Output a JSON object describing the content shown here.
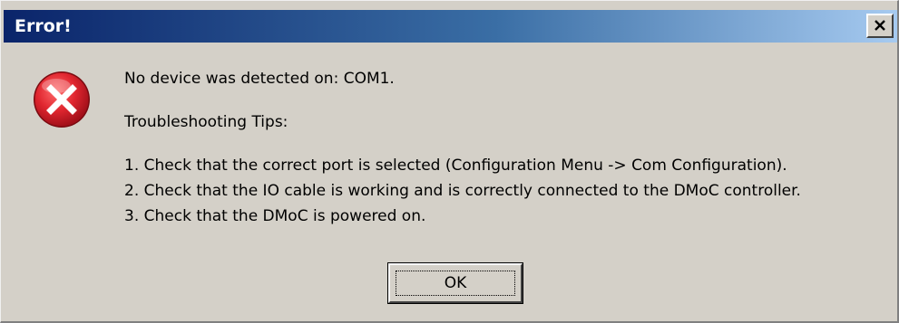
{
  "window": {
    "title": "Error!",
    "close_label": "×"
  },
  "icon": {
    "name": "error-icon",
    "color": "#d4202c"
  },
  "message": {
    "line1": "No device was detected on: COM1.",
    "heading": "Troubleshooting Tips:",
    "tips": [
      "1. Check that the correct port is selected (Configuration Menu -> Com Configuration).",
      "2. Check that the IO cable is working and is correctly connected to the DMoC controller.",
      "3. Check that the DMoC is powered on."
    ]
  },
  "buttons": {
    "ok_label": "OK"
  },
  "colors": {
    "title_start": "#0a246a",
    "title_end": "#a6caf0",
    "dialog_face": "#d4d0c8"
  }
}
